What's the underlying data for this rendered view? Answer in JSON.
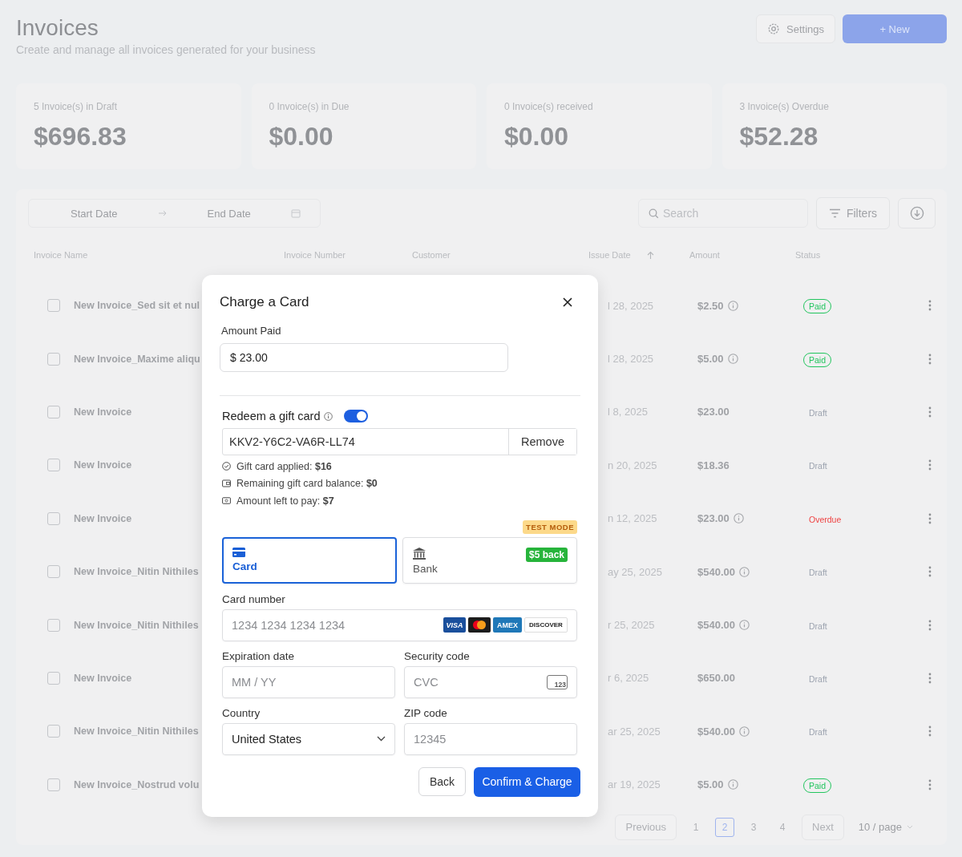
{
  "header": {
    "title": "Invoices",
    "subtitle": "Create and manage all invoices generated for your business",
    "settings_button": "Settings",
    "new_button": "+ New"
  },
  "stats": [
    {
      "label": "5 Invoice(s) in Draft",
      "amount": "$696.83"
    },
    {
      "label": "0 Invoice(s) in Due",
      "amount": "$0.00"
    },
    {
      "label": "0 Invoice(s) received",
      "amount": "$0.00"
    },
    {
      "label": "3 Invoice(s) Overdue",
      "amount": "$52.28"
    }
  ],
  "toolbar": {
    "start_date": {
      "placeholder": "Start Date"
    },
    "end_date": {
      "placeholder": "End Date"
    },
    "search": {
      "placeholder": "Search"
    },
    "filters_button": "Filters"
  },
  "table": {
    "columns": [
      "Invoice Name",
      "Invoice Number",
      "Customer",
      "Issue Date",
      "Amount",
      "Status"
    ],
    "rows": [
      {
        "checked": false,
        "name": "New Invoice_Sed sit et nul",
        "issue_date": "l 28, 2025",
        "amount": "$2.50",
        "info": true,
        "status": "Paid",
        "color": "#22c55e"
      },
      {
        "checked": false,
        "name": "New Invoice_Maxime aliqu",
        "issue_date": "l 28, 2025",
        "amount": "$5.00",
        "info": true,
        "status": "Paid",
        "color": "#22c55e"
      },
      {
        "checked": false,
        "name": "New Invoice",
        "issue_date": "l 8, 2025",
        "amount": "$23.00",
        "info": false,
        "status": "Draft",
        "color": "#9ca3af"
      },
      {
        "checked": false,
        "name": "New Invoice",
        "issue_date": "n 20, 2025",
        "amount": "$18.36",
        "info": false,
        "status": "Draft",
        "color": "#9ca3af"
      },
      {
        "checked": false,
        "name": "New Invoice",
        "issue_date": "n 12, 2025",
        "amount": "$23.00",
        "info": true,
        "status": "Overdue",
        "color": "#ef4444"
      },
      {
        "checked": false,
        "name": "New Invoice_Nitin Nithiles",
        "issue_date": "ay 25, 2025",
        "amount": "$540.00",
        "info": true,
        "status": "Draft",
        "color": "#9ca3af"
      },
      {
        "checked": false,
        "name": "New Invoice_Nitin Nithiles",
        "issue_date": "r 25, 2025",
        "amount": "$540.00",
        "info": true,
        "status": "Draft",
        "color": "#9ca3af"
      },
      {
        "checked": false,
        "name": "New Invoice",
        "issue_date": "r 6, 2025",
        "amount": "$650.00",
        "info": false,
        "status": "Draft",
        "color": "#9ca3af"
      },
      {
        "checked": false,
        "name": "New Invoice_Nitin Nithiles",
        "issue_date": "ar 25, 2025",
        "amount": "$540.00",
        "info": true,
        "status": "Draft",
        "color": "#9ca3af"
      },
      {
        "checked": false,
        "name": "New Invoice_Nostrud volu",
        "issue_date": "ar 19, 2025",
        "amount": "$5.00",
        "info": true,
        "status": "Paid",
        "color": "#22c55e"
      }
    ]
  },
  "pagination": {
    "previous": "Previous",
    "pages": [
      {
        "label": "1",
        "selected": false
      },
      {
        "label": "2",
        "selected": true
      },
      {
        "label": "3",
        "selected": false
      },
      {
        "label": "4",
        "selected": false
      }
    ],
    "next": "Next",
    "page_size": "10 / page"
  },
  "dialog": {
    "title": "Charge a Card",
    "amount_label": "Amount Paid",
    "amount_value": "$ 23.00",
    "gift_card": {
      "label": "Redeem a gift card",
      "on": true,
      "code": "KKV2-Y6C2-VA6R-LL74",
      "remove_button": "Remove",
      "lines": [
        {
          "kind": "check",
          "text": "Gift card applied: **$16**"
        },
        {
          "kind": "wallet",
          "text": "Remaining gift card balance: **$0**"
        },
        {
          "kind": "cash",
          "text": "Amount left to pay: **$7**"
        }
      ]
    },
    "test_mode": "TEST MODE",
    "methods": [
      {
        "kind": "card",
        "label": "Card",
        "selected": true
      },
      {
        "kind": "bank",
        "label": "Bank",
        "selected": false,
        "badge": "$5 back"
      }
    ],
    "card_number": {
      "label": "Card number",
      "placeholder": "1234 1234 1234 1234"
    },
    "card_brands": [
      {
        "kind": "visa",
        "label": "VISA"
      },
      {
        "kind": "mastercard"
      },
      {
        "kind": "amex",
        "label": "AMEX"
      },
      {
        "kind": "discover",
        "label": "DISCOVER"
      }
    ],
    "expiration": {
      "label": "Expiration date",
      "placeholder": "MM / YY"
    },
    "security_code": {
      "label": "Security code",
      "placeholder": "CVC",
      "icon_label": "123"
    },
    "country": {
      "label": "Country",
      "value": "United States"
    },
    "zip": {
      "label": "ZIP code",
      "placeholder": "12345"
    },
    "back_button": "Back",
    "confirm_button": "Confirm & Charge"
  }
}
